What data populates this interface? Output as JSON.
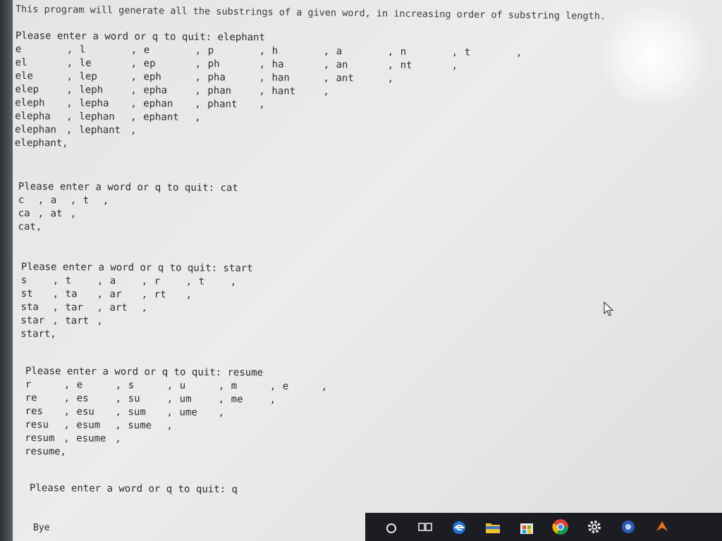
{
  "header_text": "This program will generate all the substrings of a given word, in increasing order of substring length.",
  "sessions": [
    {
      "prompt": "Please enter a word or q to quit: ",
      "input_value": "elephant",
      "rows": [
        [
          "e",
          "l",
          "e",
          "p",
          "h",
          "a",
          "n",
          "t"
        ],
        [
          "el",
          "le",
          "ep",
          "ph",
          "ha",
          "an",
          "nt"
        ],
        [
          "ele",
          "lep",
          "eph",
          "pha",
          "han",
          "ant"
        ],
        [
          "elep",
          "leph",
          "epha",
          "phan",
          "hant"
        ],
        [
          "eleph",
          "lepha",
          "ephan",
          "phant"
        ],
        [
          "elepha",
          "lephan",
          "ephant"
        ],
        [
          "elephan",
          "lephant"
        ],
        [
          "elephant"
        ]
      ]
    },
    {
      "prompt": "Please enter a word or q to quit: ",
      "input_value": "cat",
      "rows": [
        [
          "c",
          "a",
          "t"
        ],
        [
          "ca",
          "at"
        ],
        [
          "cat"
        ]
      ]
    },
    {
      "prompt": "Please enter a word or q to quit: ",
      "input_value": "start",
      "rows": [
        [
          "s",
          "t",
          "a",
          "r",
          "t"
        ],
        [
          "st",
          "ta",
          "ar",
          "rt"
        ],
        [
          "sta",
          "tar",
          "art"
        ],
        [
          "star",
          "tart"
        ],
        [
          "start"
        ]
      ]
    },
    {
      "prompt": "Please enter a word or q to quit: ",
      "input_value": "resume",
      "rows": [
        [
          "r",
          "e",
          "s",
          "u",
          "m",
          "e"
        ],
        [
          "re",
          "es",
          "su",
          "um",
          "me"
        ],
        [
          "res",
          "esu",
          "sum",
          "ume"
        ],
        [
          "resu",
          "esum",
          "sume"
        ],
        [
          "resum",
          "esume"
        ],
        [
          "resume"
        ]
      ]
    },
    {
      "prompt": "Please enter a word or q to quit: ",
      "input_value": "q",
      "rows": []
    }
  ],
  "bye_text": "Bye",
  "separator": ",",
  "taskbar_icons": [
    "search-icon",
    "task-view-icon",
    "edge-browser-icon",
    "file-explorer-icon",
    "store-icon",
    "chrome-icon",
    "settings-icon",
    "app-icon",
    "app-icon-2"
  ],
  "colors": {
    "text": "#2a2b2d",
    "screen": "#e6e7e8",
    "taskbar": "#1b1d22"
  }
}
